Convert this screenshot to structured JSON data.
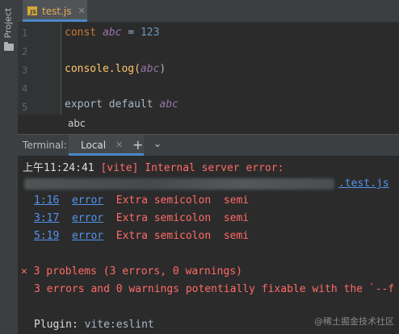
{
  "sidebar": {
    "project_label": "Project"
  },
  "tab": {
    "icon_text": "JS",
    "filename": "test.js",
    "close": "✕"
  },
  "editor": {
    "lines": [
      {
        "no": "1",
        "tokens": {
          "kw": "const",
          "var": "abc",
          "eq": " = ",
          "num": "123"
        }
      },
      {
        "no": "2"
      },
      {
        "no": "3",
        "tokens": {
          "fn": "console.log(",
          "var": "abc",
          "close": ")"
        }
      },
      {
        "no": "4"
      },
      {
        "no": "5",
        "tokens": {
          "text": "export default ",
          "var": "abc"
        }
      }
    ]
  },
  "hint": {
    "text": "abc"
  },
  "terminal_bar": {
    "label": "Terminal:",
    "tab": "Local",
    "close": "✕",
    "add": "+",
    "dropdown": "⌄"
  },
  "terminal": {
    "line1": {
      "time": "上午11:24:41",
      "msg": " [vite] Internal server error:"
    },
    "path_file": ".test.js",
    "errors": [
      {
        "loc": "1:16",
        "level": "error",
        "msg": "Extra semicolon",
        "rule": "semi"
      },
      {
        "loc": "3:17",
        "level": "error",
        "msg": "Extra semicolon",
        "rule": "semi"
      },
      {
        "loc": "5:19",
        "level": "error",
        "msg": "Extra semicolon",
        "rule": "semi"
      }
    ],
    "summary_icon": "✕",
    "summary": "3 problems (3 errors, 0 warnings)",
    "fixable": "3 errors and 0 warnings potentially fixable with the `--f",
    "plugin_label": "Plugin: ",
    "plugin_value": "vite:eslint"
  },
  "watermark": "@稀土掘金技术社区"
}
